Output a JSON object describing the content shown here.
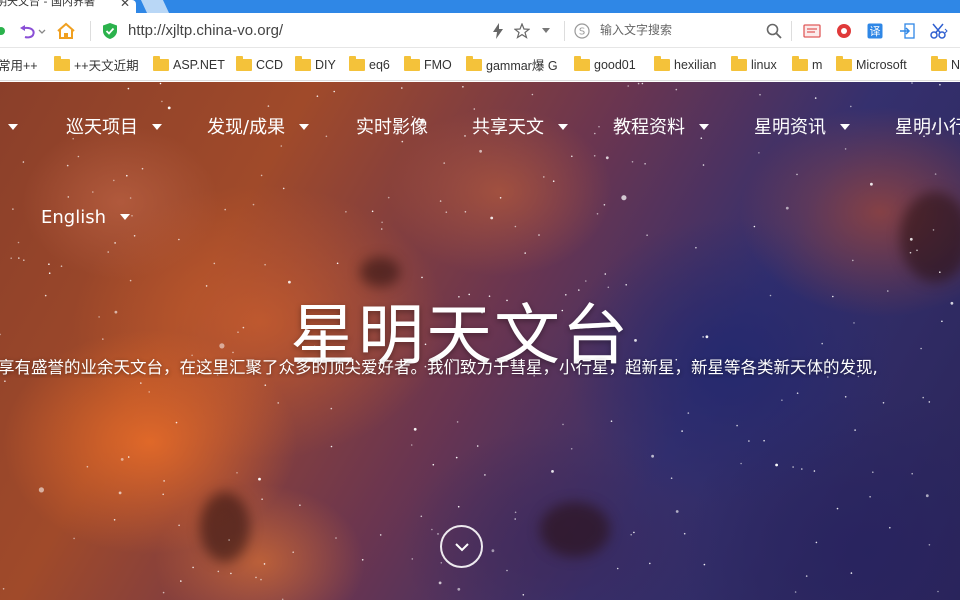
{
  "browser": {
    "tab_title": "明天文台 - 国内界著",
    "address_url": "http://xjltp.china-vo.org/",
    "search_placeholder": "输入文字搜索",
    "bookmarks": [
      {
        "label": "常用++",
        "folder": false
      },
      {
        "label": "++天文近期",
        "folder": true
      },
      {
        "label": "ASP.NET",
        "folder": true
      },
      {
        "label": "CCD",
        "folder": true
      },
      {
        "label": "DIY",
        "folder": true
      },
      {
        "label": "eq6",
        "folder": true
      },
      {
        "label": "FMO",
        "folder": true
      },
      {
        "label": "gammar爆 G",
        "folder": true
      },
      {
        "label": "good01",
        "folder": true
      },
      {
        "label": "hexilian",
        "folder": true
      },
      {
        "label": "linux",
        "folder": true
      },
      {
        "label": "m",
        "folder": true
      },
      {
        "label": "Microsoft",
        "folder": true
      },
      {
        "label": "N",
        "folder": true
      }
    ],
    "icons": [
      "back-arrow-icon",
      "undo-icon",
      "home-icon",
      "shield-icon",
      "lightning-icon",
      "star-icon",
      "dropdown-icon",
      "search-engine-icon",
      "search-icon",
      "reader-icon",
      "record-icon",
      "translate-icon",
      "exit-icon",
      "scissors-icon"
    ]
  },
  "site": {
    "nav": [
      {
        "label": "",
        "has_dropdown": true
      },
      {
        "label": "巡天项目",
        "has_dropdown": true
      },
      {
        "label": "发现/成果",
        "has_dropdown": true
      },
      {
        "label": "实时影像",
        "has_dropdown": false
      },
      {
        "label": "共享天文",
        "has_dropdown": true
      },
      {
        "label": "教程资料",
        "has_dropdown": true
      },
      {
        "label": "星明资讯",
        "has_dropdown": true
      },
      {
        "label": "星明小行",
        "has_dropdown": false
      }
    ],
    "language": "English",
    "title": "星明天文台",
    "tagline": "享有盛誉的业余天文台，在这里汇聚了众多的顶尖爱好者。我们致力于彗星，小行星，超新星，新星等各类新天体的发现,",
    "scroll_icon": "chevron-down-icon"
  },
  "colors": {
    "tabstrip": "#2f87e6",
    "folder": "#f4c23a",
    "shield": "#2bb24c",
    "undo": "#8a4fd6",
    "home": "#f0a020"
  }
}
